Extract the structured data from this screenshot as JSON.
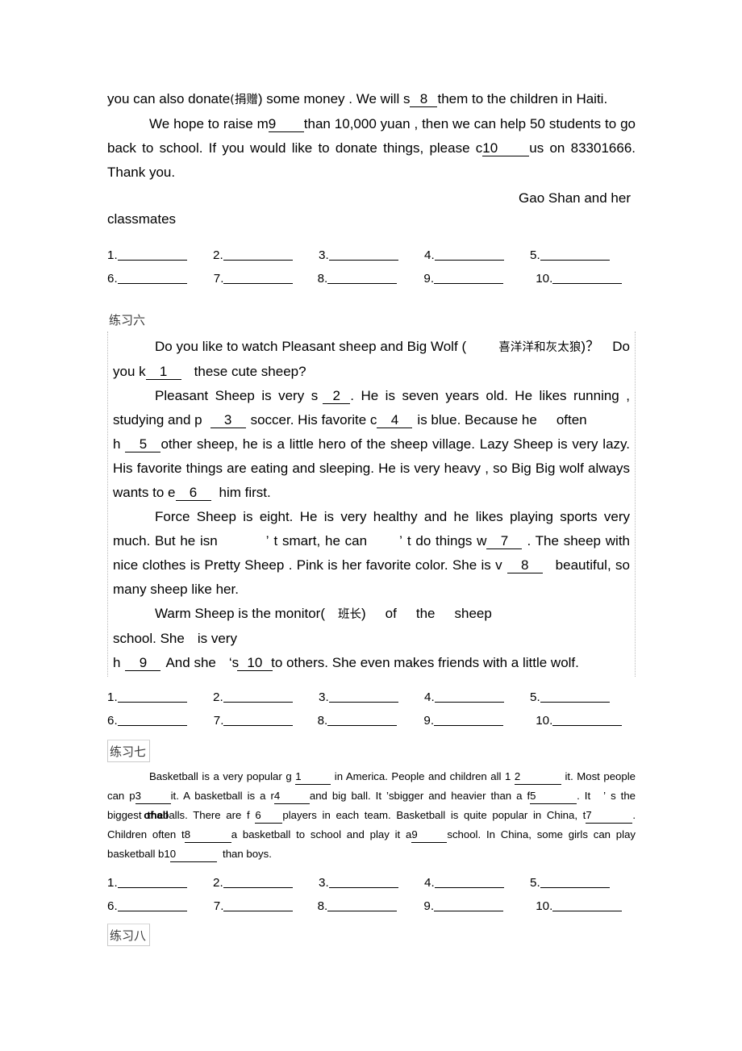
{
  "document": {
    "letter": {
      "line1_a": "you can also donate",
      "line1_paren_cn": "(捐赠",
      "line1_b": ") some money . We will s",
      "line1_blank": "8",
      "line1_c": "them to the children in Haiti.",
      "line2_a": "We hope to raise m",
      "line2_blank": "9",
      "line2_b": "than 10,000 yuan , then we can help 50 students to go back to school. If you would like to donate things, please c",
      "line2_blank2": "10",
      "line2_c": "us on 83301666. Thank you.",
      "signature": "Gao  Shan and  her",
      "signature2": "classmates"
    },
    "answers_1": {
      "row1": [
        {
          "num": "1."
        },
        {
          "num": "2."
        },
        {
          "num": "3."
        },
        {
          "num": "4."
        },
        {
          "num": "5."
        }
      ],
      "row2": [
        {
          "num": "6."
        },
        {
          "num": "7."
        },
        {
          "num": "8."
        },
        {
          "num": "9."
        },
        {
          "num": "10."
        }
      ]
    },
    "exercise6": {
      "heading": "练习六",
      "p1_a": "Do you like to watch Pleasant sheep and Big Wolf (",
      "p1_cn": "喜洋洋和灰太狼",
      "p1_b": ")？",
      "p1_c": "Do you k",
      "p1_blank": "1",
      "p1_d": "these cute sheep?",
      "p2_a": "Pleasant Sheep is very s",
      "p2_blank1": "2",
      "p2_b": ". He is seven years old. He likes running , studying and p",
      "p2_blank2": "3",
      "p2_c": "soccer. His favorite c",
      "p2_blank3": "4",
      "p2_d": "is blue. Because he",
      "p2_e": "often",
      "p2_f": "h",
      "p2_blank4": "5",
      "p2_g": "other sheep, he is a little hero of the sheep village. Lazy Sheep is very lazy. His favorite things are eating and sleeping. He is very heavy , so Big Big wolf always wants to e",
      "p2_blank5": "6",
      "p2_h": "him first.",
      "p3_a": "Force Sheep is eight. He is very healthy and he likes playing sports very much. But he isn",
      "p3_ap1": "’",
      "p3_b": "t smart, he can",
      "p3_ap2": "’",
      "p3_c": "t do things w",
      "p3_blank1": "7",
      "p3_d": ". The sheep with nice clothes is Pretty Sheep . Pink is her favorite color. She is v",
      "p3_blank2": "8",
      "p3_e": "beautiful, so many sheep like her.",
      "p4_a": "Warm Sheep is the monitor(",
      "p4_cn": "班长",
      "p4_b": ")",
      "p4_c": "of",
      "p4_d": "the",
      "p4_e": "sheep",
      "p4_f": "school. She",
      "p4_g": "is very",
      "p4_h": "h",
      "p4_blank1": "9",
      "p4_i": "And she",
      "p4_ap": "‘s",
      "p4_blank2": "10",
      "p4_j": "to others. She even makes friends with a little wolf."
    },
    "answers_2": {
      "row1": [
        {
          "num": "1."
        },
        {
          "num": "2."
        },
        {
          "num": "3."
        },
        {
          "num": "4."
        },
        {
          "num": "5."
        }
      ],
      "row2": [
        {
          "num": "6."
        },
        {
          "num": "7."
        },
        {
          "num": "8."
        },
        {
          "num": "9."
        },
        {
          "num": "10."
        }
      ]
    },
    "exercise7": {
      "heading": "练习七",
      "p_a": "Basketball is a very popular g",
      "p_blank1": "1",
      "p_b": "in America. People and children all 1",
      "p_blank2": "2",
      "p_c": "it. Most people can p",
      "p_blank3": "3",
      "p_d": "it. A basketball is a r",
      "p_blank4": "4",
      "p_e": "and big ball. It",
      "p_ap1": "’",
      "p_f": "s",
      "p_g": "bigger and heavier than a f",
      "p_blank5": "5",
      "p_h": ". It",
      "p_ap2": "’",
      "p_i": "s the biggest",
      "p_j": "the",
      "p_j2": "of all",
      "p_k": "balls. There are f",
      "p_blank6": "6",
      "p_l": "players in each team. Basketball is quite popular in China, t",
      "p_blank7": "7",
      "p_m": ". Children often t",
      "p_blank8": "8",
      "p_n": "a basketball to school and play it a",
      "p_blank9": "9",
      "p_o": "school. In China, some girls can play basketball b1",
      "p_blank10": "0",
      "p_p": "than boys."
    },
    "answers_3": {
      "row1": [
        {
          "num": "1."
        },
        {
          "num": "2."
        },
        {
          "num": "3."
        },
        {
          "num": "4."
        },
        {
          "num": "5."
        }
      ],
      "row2": [
        {
          "num": "6."
        },
        {
          "num": "7."
        },
        {
          "num": "8."
        },
        {
          "num": "9."
        },
        {
          "num": "10."
        }
      ]
    },
    "exercise8": {
      "heading": "练习八"
    }
  }
}
